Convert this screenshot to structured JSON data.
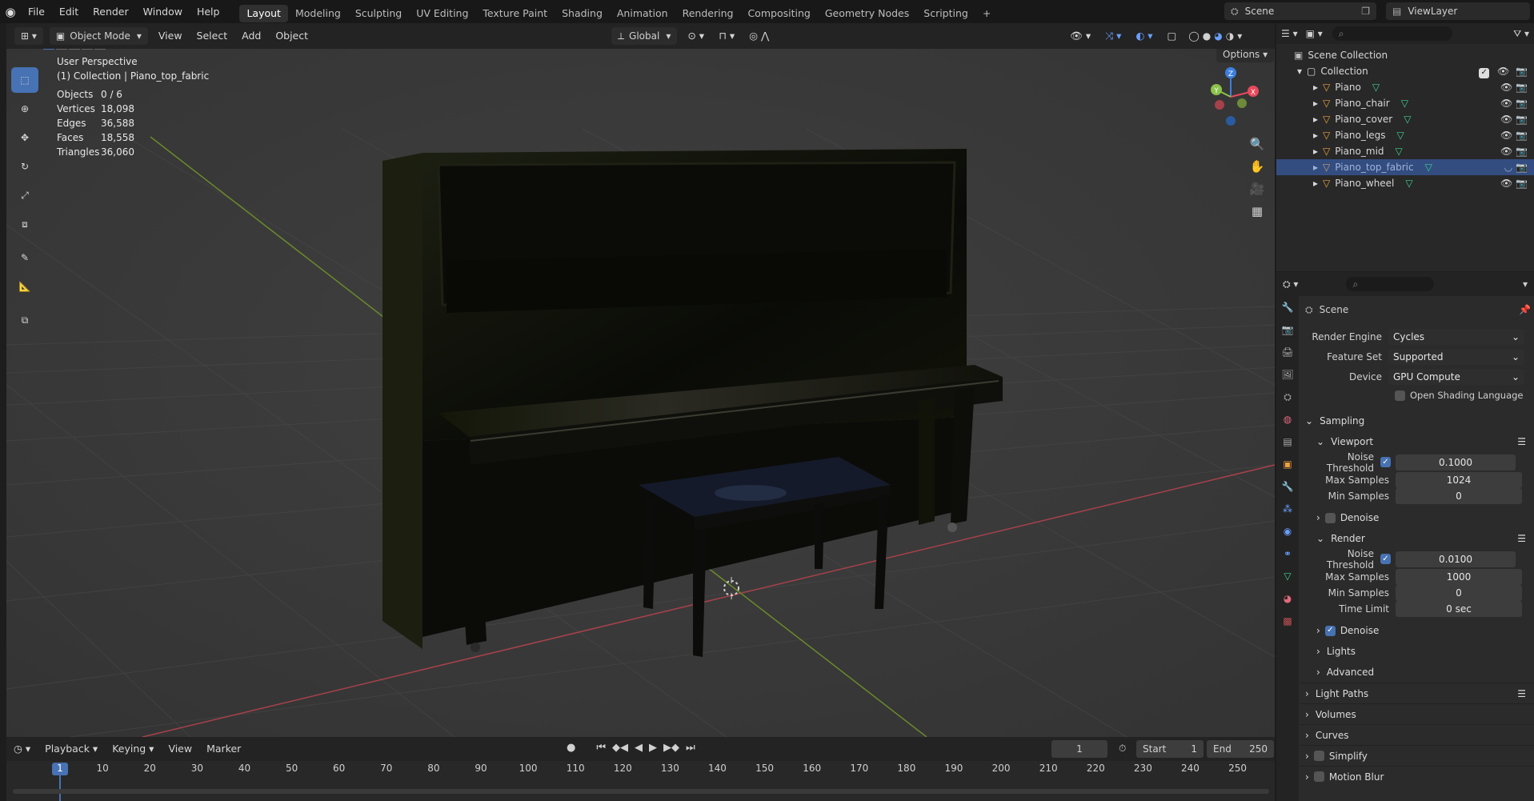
{
  "topbar": {
    "menus": [
      "File",
      "Edit",
      "Render",
      "Window",
      "Help"
    ],
    "workspaces": [
      "Layout",
      "Modeling",
      "Sculpting",
      "UV Editing",
      "Texture Paint",
      "Shading",
      "Animation",
      "Rendering",
      "Compositing",
      "Geometry Nodes",
      "Scripting"
    ],
    "active_workspace": "Layout",
    "add_tab": "+",
    "scene_name": "Scene",
    "view_layer": "ViewLayer"
  },
  "viewport_header": {
    "mode": "Object Mode",
    "menus": [
      "View",
      "Select",
      "Add",
      "Object"
    ],
    "transform_orientation": "Global",
    "options_label": "Options"
  },
  "viewport": {
    "perspective": "User Perspective",
    "collection_info": "(1) Collection | Piano_top_fabric",
    "stats": [
      {
        "label": "Objects",
        "value": "0 / 6"
      },
      {
        "label": "Vertices",
        "value": "18,098"
      },
      {
        "label": "Edges",
        "value": "36,588"
      },
      {
        "label": "Faces",
        "value": "18,558"
      },
      {
        "label": "Triangles",
        "value": "36,060"
      }
    ],
    "gizmo_axes": {
      "x": "X",
      "y": "Y",
      "z": "Z"
    }
  },
  "outliner": {
    "root": "Scene Collection",
    "collection": "Collection",
    "objects": [
      {
        "name": "Piano",
        "selected": false
      },
      {
        "name": "Piano_chair",
        "selected": false
      },
      {
        "name": "Piano_cover",
        "selected": false
      },
      {
        "name": "Piano_legs",
        "selected": false
      },
      {
        "name": "Piano_mid",
        "selected": false
      },
      {
        "name": "Piano_top_fabric",
        "selected": true
      },
      {
        "name": "Piano_wheel",
        "selected": false
      }
    ]
  },
  "properties": {
    "context": "Scene",
    "render_engine_label": "Render Engine",
    "render_engine": "Cycles",
    "feature_set_label": "Feature Set",
    "feature_set": "Supported",
    "device_label": "Device",
    "device": "GPU Compute",
    "osl_label": "Open Shading Language",
    "sampling": {
      "title": "Sampling",
      "viewport": {
        "title": "Viewport",
        "noise_threshold_label": "Noise Threshold",
        "noise_threshold": "0.1000",
        "max_samples_label": "Max Samples",
        "max_samples": "1024",
        "min_samples_label": "Min Samples",
        "min_samples": "0",
        "denoise_label": "Denoise"
      },
      "render": {
        "title": "Render",
        "noise_threshold_label": "Noise Threshold",
        "noise_threshold": "0.0100",
        "max_samples_label": "Max Samples",
        "max_samples": "1000",
        "min_samples_label": "Min Samples",
        "min_samples": "0",
        "time_limit_label": "Time Limit",
        "time_limit": "0 sec",
        "denoise_label": "Denoise"
      },
      "lights": "Lights",
      "advanced": "Advanced"
    },
    "panels": [
      "Light Paths",
      "Volumes",
      "Curves",
      "Simplify",
      "Motion Blur"
    ]
  },
  "timeline": {
    "menus": [
      "Playback",
      "Keying",
      "View",
      "Marker"
    ],
    "current_frame": "1",
    "start_label": "Start",
    "start": "1",
    "end_label": "End",
    "end": "250",
    "ticks": [
      "1",
      "10",
      "20",
      "30",
      "40",
      "50",
      "60",
      "70",
      "80",
      "90",
      "100",
      "110",
      "120",
      "130",
      "140",
      "150",
      "160",
      "170",
      "180",
      "190",
      "200",
      "210",
      "220",
      "230",
      "240",
      "250"
    ]
  },
  "colors": {
    "accent": "#4772b3",
    "selection": "#334d80",
    "axis_x": "#e8495b",
    "axis_y": "#8bc34a",
    "axis_z": "#3d7fe0"
  }
}
